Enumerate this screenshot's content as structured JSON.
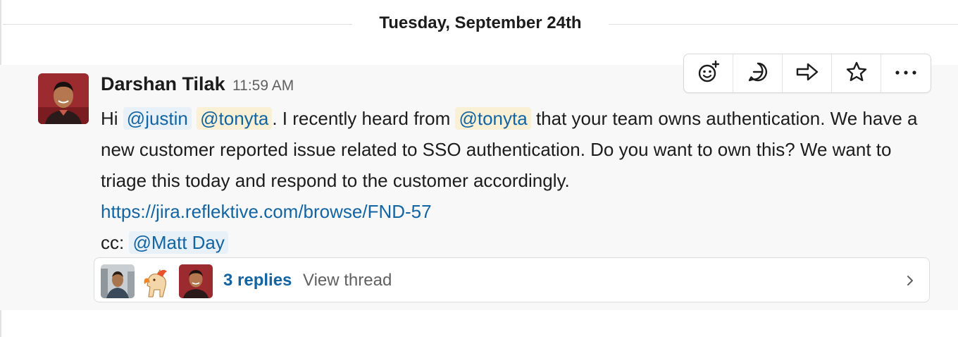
{
  "date_divider": {
    "label": "Tuesday, September 24th"
  },
  "message": {
    "author": "Darshan Tilak",
    "time": "11:59 AM",
    "greeting": "Hi",
    "mention_justin": "@justin",
    "mention_tonyta": "@tonyta",
    "text_1": ". I recently heard from",
    "mention_tonyta_2": "@tonyta",
    "text_2": "that your team owns authentication. We have a new customer reported issue related to SSO authentication. Do you want to own this? We want to triage this today and respond to the customer accordingly.",
    "link": "https://jira.reflektive.com/browse/FND-57",
    "cc_label": "cc:",
    "mention_matt": "@Matt Day"
  },
  "thread": {
    "replies_label": "3 replies",
    "view_thread_label": "View thread"
  },
  "toolbar": {
    "icons": [
      "add-reaction-icon",
      "reply-in-thread-icon",
      "share-icon",
      "star-icon",
      "more-actions-icon"
    ]
  },
  "colors": {
    "link": "#1264a3",
    "mention_bg": "#e8f1f8",
    "mention_highlight_bg": "#f9f0d5",
    "message_bg": "#f8f8f8",
    "muted_text": "#616061"
  }
}
